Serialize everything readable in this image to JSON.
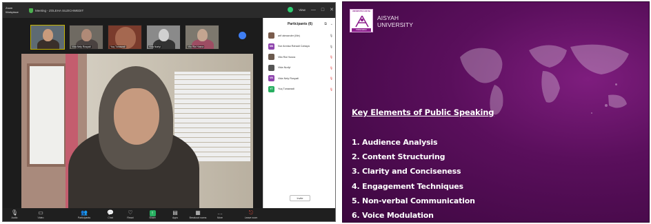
{
  "zoom": {
    "app_name": "Zoom Workplace",
    "meeting_title": "Meeting - ZOLEHA SUZICHWEDIT",
    "view_label": "View",
    "window_controls": [
      "—",
      "□",
      "✕"
    ],
    "thumbnails": [
      {
        "name": ""
      },
      {
        "name": "Vida Nely Rosyati"
      },
      {
        "name": "Yuq Tunawadi"
      },
      {
        "name": "Vida Nurlyi"
      },
      {
        "name": "Vita Ria Husna"
      }
    ],
    "main_video_name": "",
    "participants_title": "Participants (6)",
    "participants": [
      {
        "initials": "",
        "name": "arif alexander (Me)",
        "color": "#7a5c4c",
        "icon": "🎙",
        "muted": false
      },
      {
        "initials": "NN",
        "name": "Nur Annisa Rahadi Cahaya",
        "color": "#8e44ad",
        "icon": "🎙",
        "muted": false
      },
      {
        "initials": "",
        "name": "Vita Ria Husna",
        "color": "#6b5a4e",
        "icon": "🎙",
        "muted": true
      },
      {
        "initials": "",
        "name": "Vida Nurlyi",
        "color": "#555555",
        "icon": "🎙",
        "muted": true
      },
      {
        "initials": "VN",
        "name": "Vida Nely Rosyati",
        "color": "#8e44ad",
        "icon": "🎙",
        "muted": true
      },
      {
        "initials": "YT",
        "name": "Yuq Tunawadi",
        "color": "#27ae60",
        "icon": "🎙",
        "muted": true
      }
    ],
    "invite_label": "Invite",
    "toolbar": [
      {
        "glyph": "🎙",
        "label": "Audio"
      },
      {
        "glyph": "▭",
        "label": "Video"
      },
      {
        "glyph": "👥",
        "label": "Participants"
      },
      {
        "glyph": "💬",
        "label": "Chat"
      },
      {
        "glyph": "♡",
        "label": "React"
      },
      {
        "glyph": "↑",
        "label": "Share"
      },
      {
        "glyph": "▤",
        "label": "Apps"
      },
      {
        "glyph": "▦",
        "label": "Breakout rooms"
      },
      {
        "glyph": "…",
        "label": "More"
      },
      {
        "glyph": "⎋",
        "label": "Leave room"
      }
    ]
  },
  "slide": {
    "logo_top_text": "UNIVERSITAS AISYAH",
    "logo_bottom_text": "PRINGSEWU",
    "brand_line1": "AISYAH",
    "brand_line2": "UNIVERSITY",
    "heading": "Key Elements of Public Speaking",
    "points": [
      "1. Audience Analysis",
      "2. Content Structuring",
      "3. Clarity and Conciseness",
      "4. Engagement Techniques",
      "5. Non-verbal Communication",
      "6. Voice Modulation"
    ],
    "colors": {
      "background": "#5a0f5c",
      "text": "#ffffff",
      "accent": "#8c1d8c"
    }
  }
}
